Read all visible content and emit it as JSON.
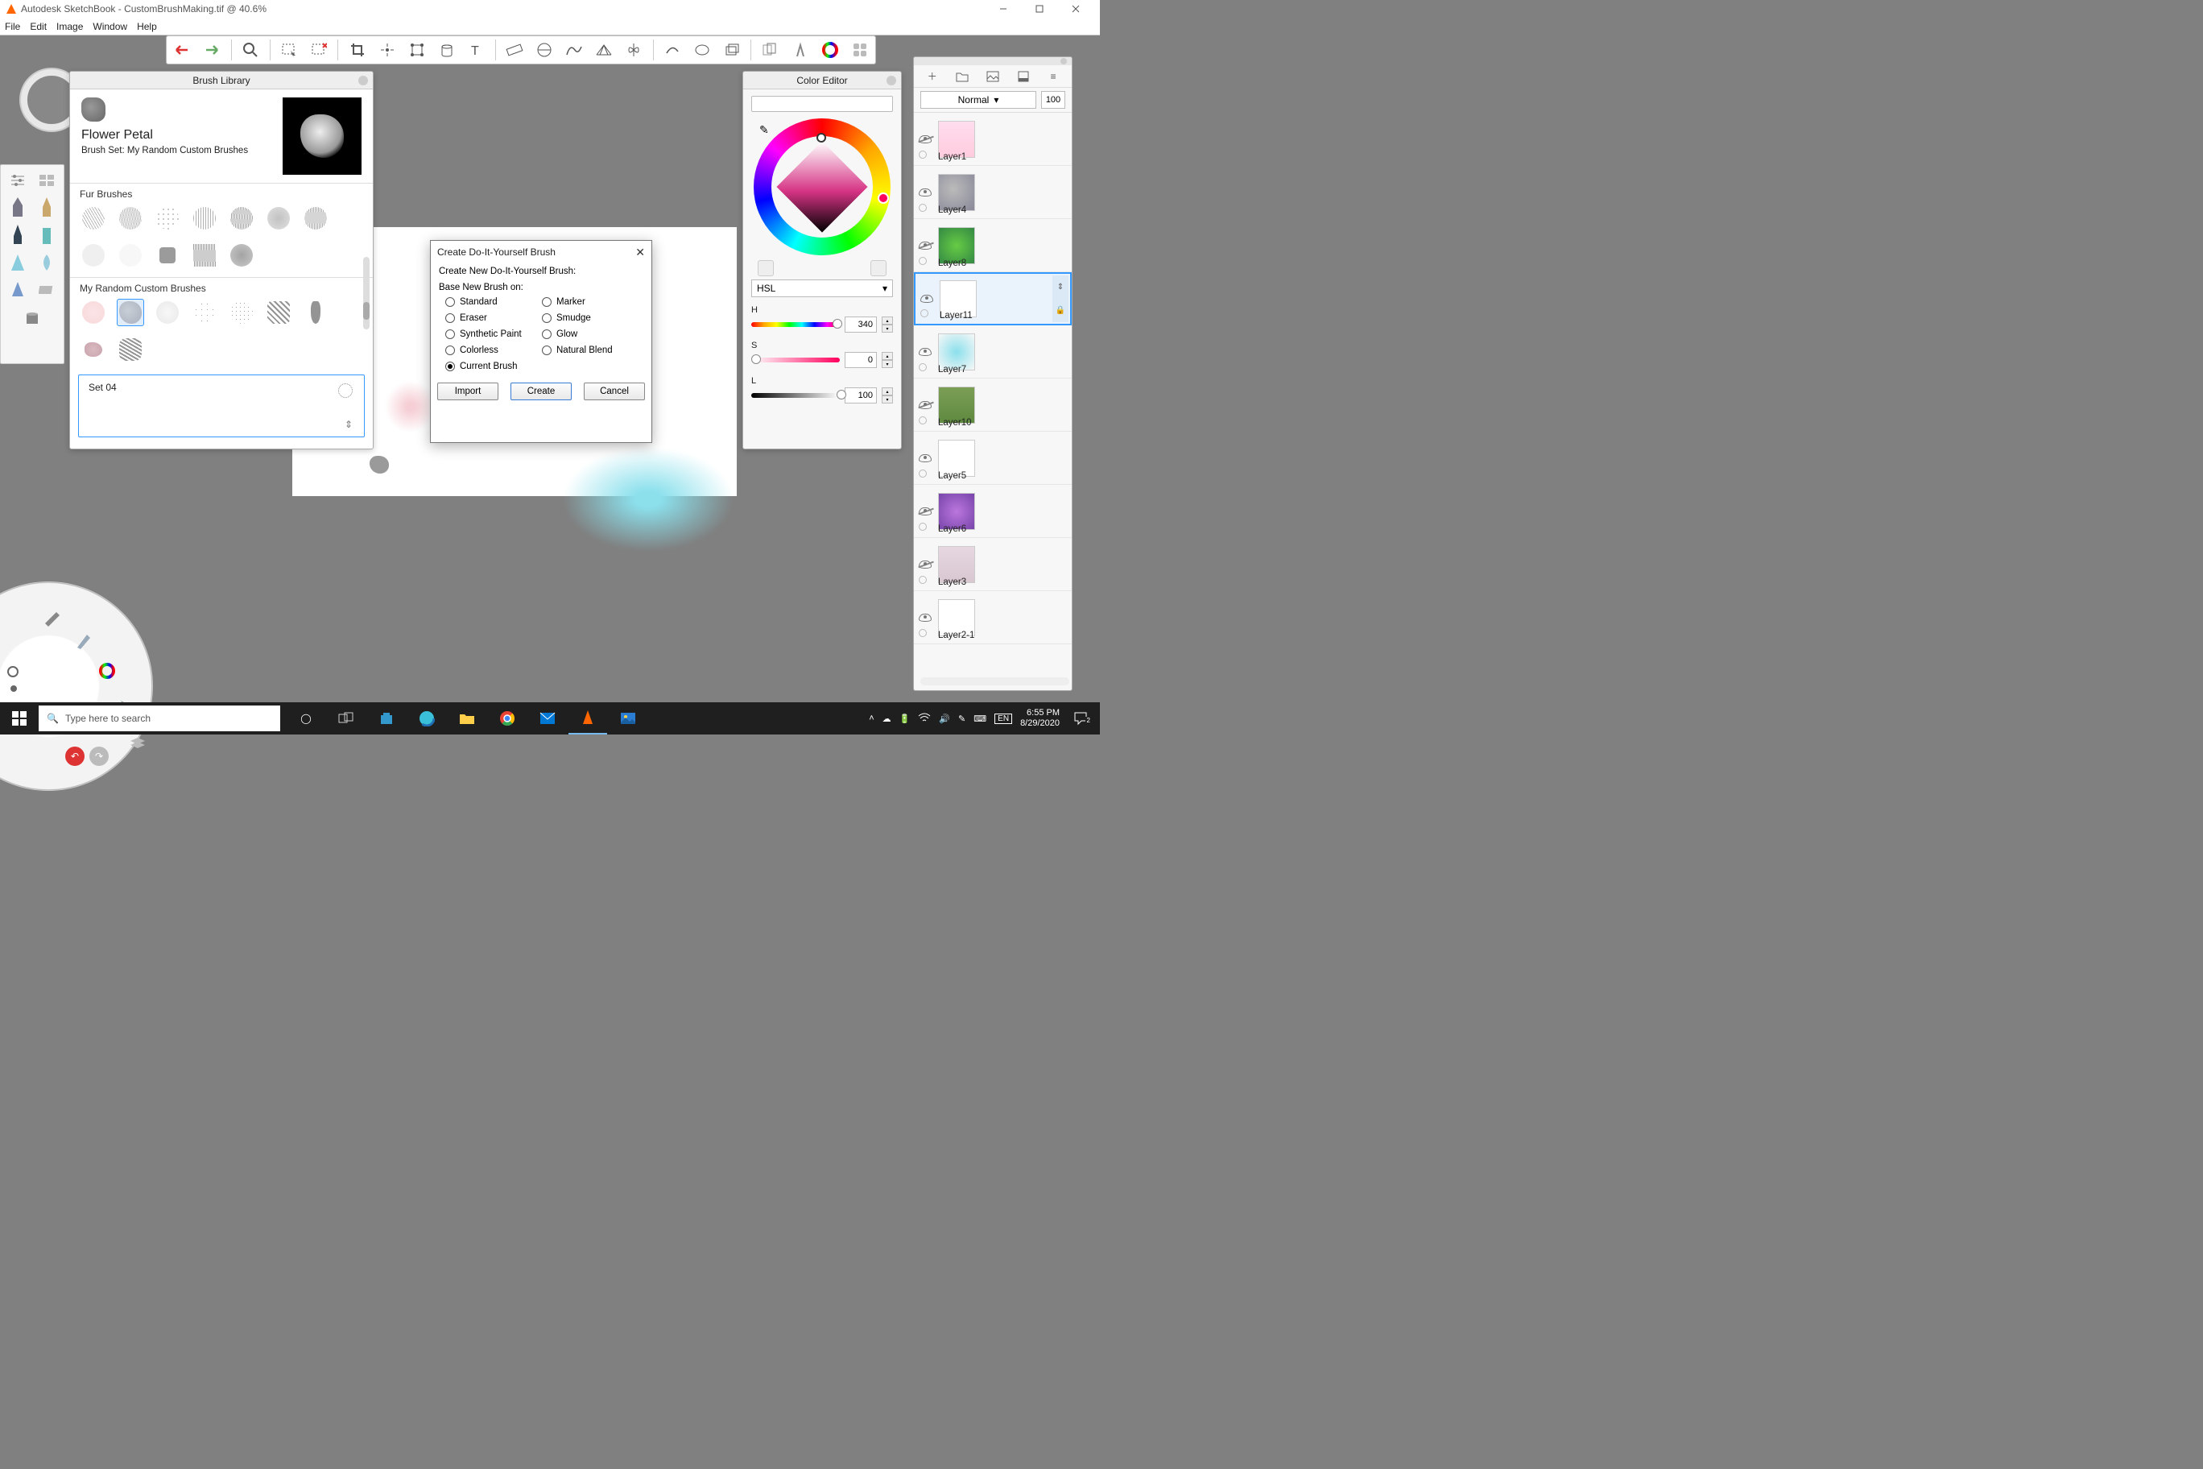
{
  "titlebar": {
    "text": "Autodesk SketchBook - CustomBrushMaking.tif @ 40.6%"
  },
  "menu": {
    "file": "File",
    "edit": "Edit",
    "image": "Image",
    "window": "Window",
    "help": "Help"
  },
  "brush_library": {
    "title": "Brush Library",
    "brush_name": "Flower Petal",
    "brush_set_label": "Brush Set: My Random Custom Brushes",
    "section_fur": "Fur Brushes",
    "section_custom": "My Random Custom Brushes",
    "new_set_name": "Set 04"
  },
  "dialog": {
    "title": "Create Do-It-Yourself Brush",
    "header": "Create New Do-It-Yourself Brush:",
    "sub": "Base New Brush on:",
    "opts": {
      "standard": "Standard",
      "marker": "Marker",
      "eraser": "Eraser",
      "smudge": "Smudge",
      "synthetic": "Synthetic Paint",
      "glow": "Glow",
      "colorless": "Colorless",
      "natural": "Natural Blend",
      "current": "Current Brush"
    },
    "btn_import": "Import",
    "btn_create": "Create",
    "btn_cancel": "Cancel"
  },
  "color_editor": {
    "title": "Color Editor",
    "mode": "HSL",
    "h_label": "H",
    "h_value": "340",
    "s_label": "S",
    "s_value": "0",
    "l_label": "L",
    "l_value": "100"
  },
  "layers": {
    "blend_mode": "Normal",
    "opacity": "100",
    "items": [
      {
        "name": "Layer1",
        "visible": false
      },
      {
        "name": "Layer4",
        "visible": true
      },
      {
        "name": "Layer8",
        "visible": false
      },
      {
        "name": "Layer11",
        "visible": true,
        "selected": true
      },
      {
        "name": "Layer7",
        "visible": true
      },
      {
        "name": "Layer10",
        "visible": false
      },
      {
        "name": "Layer5",
        "visible": true
      },
      {
        "name": "Layer6",
        "visible": false
      },
      {
        "name": "Layer3",
        "visible": false
      },
      {
        "name": "Layer2-1",
        "visible": true
      }
    ]
  },
  "taskbar": {
    "search_placeholder": "Type here to search",
    "time": "6:55 PM",
    "date": "8/29/2020",
    "notif_count": "2"
  }
}
